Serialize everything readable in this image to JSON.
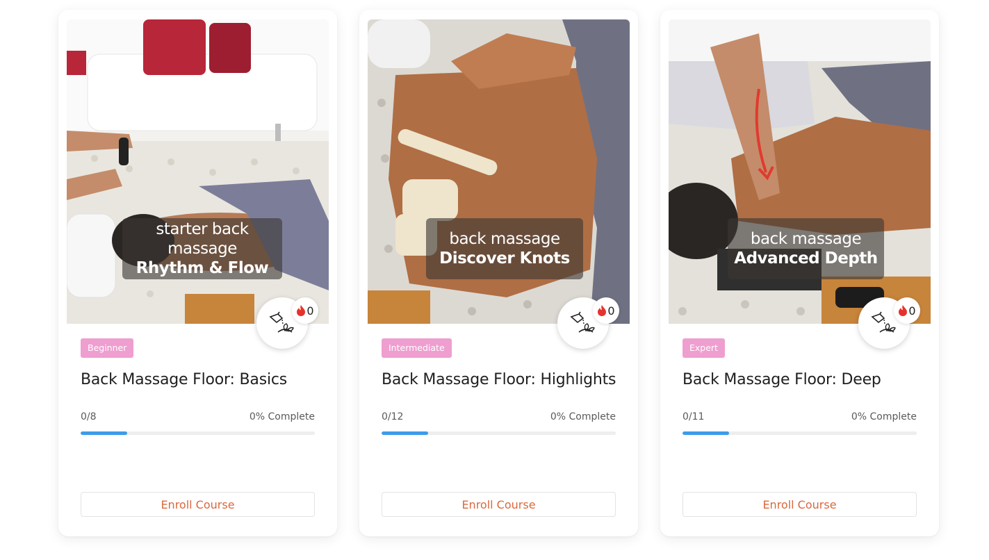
{
  "colors": {
    "level_badge": "#ef9ed0",
    "progress_fill": "#3d9be9",
    "enroll_text": "#d9683c",
    "fire_icon": "#e5322d"
  },
  "courses": [
    {
      "overlay_sub": "starter back massage",
      "overlay_main": "Rhythm & Flow",
      "level": "Beginner",
      "title": "Back Massage Floor: Basics",
      "progress_count": "0/8",
      "progress_label": "0% Complete",
      "progress_fill_fraction": 0.2,
      "fire_count": "0",
      "enroll_label": "Enroll Course",
      "badge_icon": "oil-pour-plant-icon",
      "streak_icon": "fire-icon"
    },
    {
      "overlay_sub": "back massage",
      "overlay_main": "Discover Knots",
      "level": "Intermediate",
      "title": "Back Massage Floor: Highlights",
      "progress_count": "0/12",
      "progress_label": "0% Complete",
      "progress_fill_fraction": 0.2,
      "fire_count": "0",
      "enroll_label": "Enroll Course",
      "badge_icon": "oil-pour-plant-icon",
      "streak_icon": "fire-icon"
    },
    {
      "overlay_sub": "back massage",
      "overlay_main": "Advanced Depth",
      "level": "Expert",
      "title": "Back Massage Floor: Deep",
      "progress_count": "0/11",
      "progress_label": "0% Complete",
      "progress_fill_fraction": 0.2,
      "fire_count": "0",
      "enroll_label": "Enroll Course",
      "badge_icon": "oil-pour-plant-icon",
      "streak_icon": "fire-icon"
    }
  ]
}
